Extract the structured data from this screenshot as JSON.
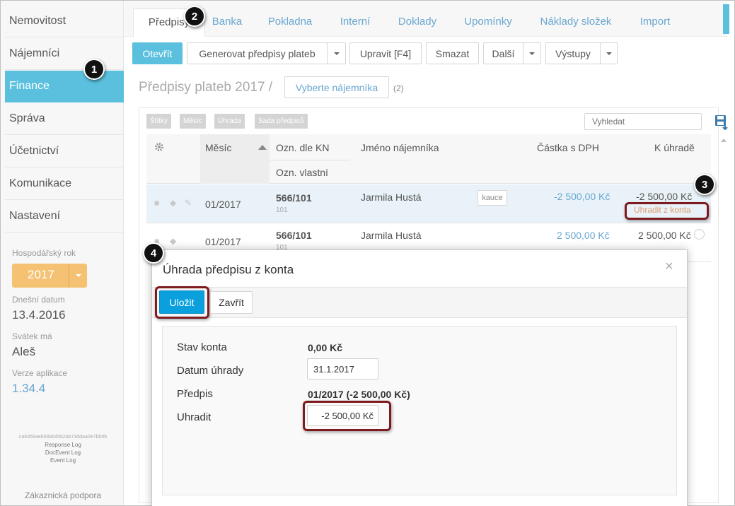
{
  "sidebar": {
    "items": [
      {
        "label": "Nemovitost"
      },
      {
        "label": "Nájemníci"
      },
      {
        "label": "Finance"
      },
      {
        "label": "Správa"
      },
      {
        "label": "Účetnictví"
      },
      {
        "label": "Komunikace"
      },
      {
        "label": "Nastavení"
      }
    ],
    "fiscal_year_label": "Hospodářský rok",
    "fiscal_year_value": "2017",
    "today_label": "Dnešní datum",
    "today_value": "13.4.2016",
    "nameday_label": "Svátek má",
    "nameday_value": "Aleš",
    "version_label": "Verze aplikace",
    "version_value": "1.34.4",
    "hash": "ca6358aeb58a54562ab73ddaa0e7bb9b",
    "logs": [
      "Response Log",
      "DocEvent Log",
      "Event Log"
    ],
    "support": "Zákaznická podpora"
  },
  "tabs": [
    {
      "label": "Předpisy"
    },
    {
      "label": "Banka"
    },
    {
      "label": "Pokladna"
    },
    {
      "label": "Interní"
    },
    {
      "label": "Doklady"
    },
    {
      "label": "Upomínky"
    },
    {
      "label": "Náklady složek"
    },
    {
      "label": "Import"
    }
  ],
  "toolbar": {
    "open": "Otevřít",
    "generate": "Generovat předpisy plateb",
    "edit": "Upravit [F4]",
    "delete": "Smazat",
    "more": "Další",
    "outputs": "Výstupy"
  },
  "page": {
    "title": "Předpisy plateb 2017 /",
    "select_tenant": "Vyberte nájemníka",
    "count": "(2)"
  },
  "filters": [
    "Štítky",
    "Měsíc",
    "Úhrada",
    "Sada předpisů"
  ],
  "search": {
    "placeholder": "Vyhledat"
  },
  "table": {
    "headers": {
      "month": "Měsíc",
      "kn": "Ozn. dle KN",
      "own": "Ozn. vlastní",
      "tenant": "Jméno nájemníka",
      "amount": "Částka s DPH",
      "due": "K úhradě"
    },
    "rows": [
      {
        "month": "01/2017",
        "kn": "566/101",
        "own": "101",
        "tenant": "Jarmila Hustá",
        "tag": "kauce",
        "amount": "-2 500,00 Kč",
        "due": "-2 500,00 Kč",
        "action": "Uhradit z konta"
      },
      {
        "month": "01/2017",
        "kn": "566/101",
        "own": "101",
        "tenant": "Jarmila Hustá",
        "amount": "2 500,00 Kč",
        "due": "2 500,00 Kč"
      }
    ]
  },
  "modal": {
    "title": "Úhrada předpisu z konta",
    "save": "Uložit",
    "close": "Zavřít",
    "fields": {
      "balance_label": "Stav konta",
      "balance_value": "0,00 Kč",
      "date_label": "Datum úhrady",
      "date_value": "31.1.2017",
      "prescription_label": "Předpis",
      "prescription_value": "01/2017 (-2 500,00 Kč)",
      "pay_label": "Uhradit",
      "pay_value": "-2 500,00 Kč"
    }
  },
  "callouts": [
    "1",
    "2",
    "3",
    "4"
  ],
  "colors": {
    "accent": "#5bc0de",
    "highlight": "#7d1a1f",
    "link": "#6aa7d0",
    "year": "#f5c173"
  }
}
